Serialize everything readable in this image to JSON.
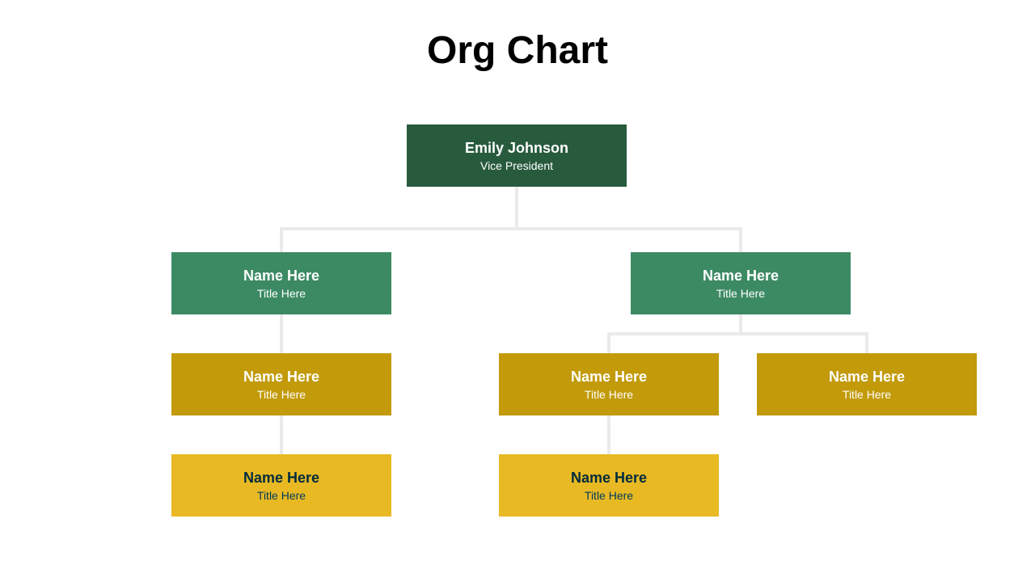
{
  "title": "Org Chart",
  "colors": {
    "level1": "#285B3E",
    "level2": "#3C8A64",
    "level3": "#C29A0A",
    "level4": "#E8B923",
    "connector": "#EAEAEA"
  },
  "nodes": {
    "root": {
      "name": "Emily Johnson",
      "title": "Vice President"
    },
    "l2a": {
      "name": "Name Here",
      "title": "Title Here"
    },
    "l2b": {
      "name": "Name Here",
      "title": "Title Here"
    },
    "l3a": {
      "name": "Name Here",
      "title": "Title Here"
    },
    "l3b": {
      "name": "Name Here",
      "title": "Title Here"
    },
    "l3c": {
      "name": "Name Here",
      "title": "Title Here"
    },
    "l4a": {
      "name": "Name Here",
      "title": "Title Here"
    },
    "l4b": {
      "name": "Name Here",
      "title": "Title Here"
    }
  }
}
